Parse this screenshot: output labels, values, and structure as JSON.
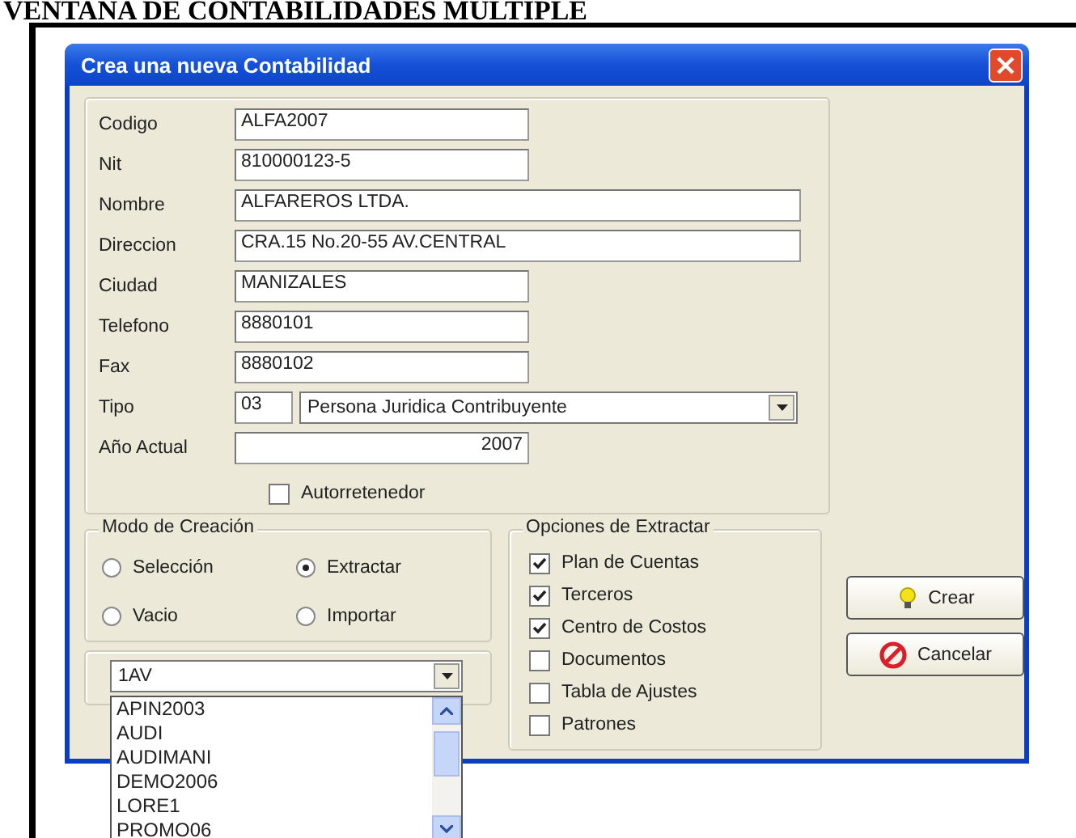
{
  "heading": "VENTANA DE CONTABILIDADES MULTIPLE",
  "window": {
    "title": "Crea una nueva Contabilidad"
  },
  "fields": [
    {
      "label": "Codigo",
      "value": "ALFA2007",
      "kind": "short"
    },
    {
      "label": "Nit",
      "value": "810000123-5",
      "kind": "short"
    },
    {
      "label": "Nombre",
      "value": "ALFAREROS LTDA.",
      "kind": "long"
    },
    {
      "label": "Direccion",
      "value": "CRA.15 No.20-55 AV.CENTRAL",
      "kind": "long"
    },
    {
      "label": "Ciudad",
      "value": "MANIZALES",
      "kind": "short"
    },
    {
      "label": "Telefono",
      "value": "8880101",
      "kind": "short"
    },
    {
      "label": "Fax",
      "value": "8880102",
      "kind": "short"
    },
    {
      "label": "Tipo",
      "code": "03",
      "value": "Persona Juridica Contribuyente",
      "kind": "select"
    },
    {
      "label": "Año Actual",
      "value": "2007",
      "kind": "number"
    }
  ],
  "autorretenedor": {
    "label": "Autorretenedor",
    "checked": false
  },
  "modo": {
    "title": "Modo de Creación",
    "options": [
      {
        "label": "Selección",
        "selected": false
      },
      {
        "label": "Extractar",
        "selected": true
      },
      {
        "label": "Vacio",
        "selected": false
      },
      {
        "label": "Importar",
        "selected": false
      }
    ]
  },
  "source": {
    "value": "1AV",
    "expanded": true,
    "items": [
      "APIN2003",
      "AUDI",
      "AUDIMANI",
      "DEMO2006",
      "LORE1",
      "PROMO06"
    ]
  },
  "opciones": {
    "title": "Opciones de Extractar",
    "items": [
      {
        "label": "Plan de Cuentas",
        "checked": true
      },
      {
        "label": "Terceros",
        "checked": true
      },
      {
        "label": "Centro de Costos",
        "checked": true
      },
      {
        "label": "Documentos",
        "checked": false
      },
      {
        "label": "Tabla de Ajustes",
        "checked": false
      },
      {
        "label": "Patrones",
        "checked": false
      }
    ]
  },
  "buttons": [
    {
      "label": "Crear",
      "kind": "create"
    },
    {
      "label": "Cancelar",
      "kind": "cancel"
    }
  ]
}
